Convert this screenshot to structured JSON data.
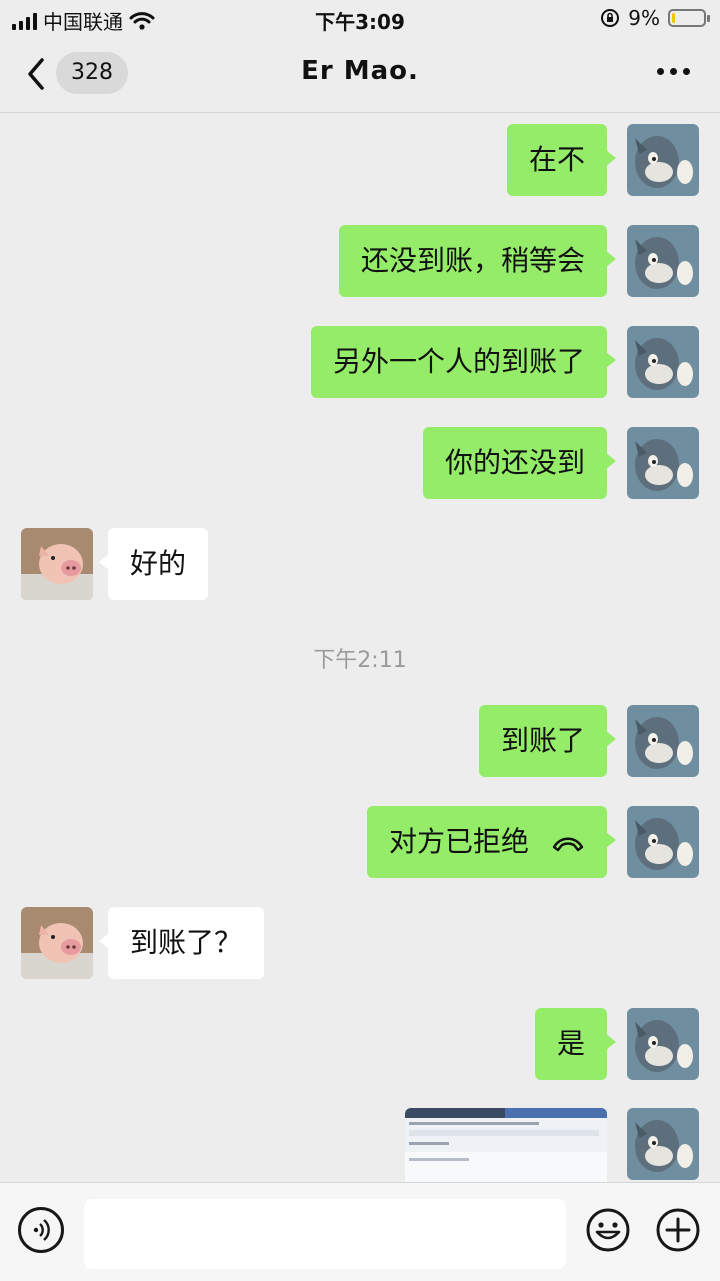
{
  "status_bar": {
    "carrier": "中国联通",
    "time": "下午3:09",
    "battery_percent": "9%",
    "battery_level": 0.09,
    "signal_icon": "signal-icon",
    "wifi_icon": "wifi-icon",
    "lock_icon": "rotation-lock-icon"
  },
  "nav": {
    "unread_count": "328",
    "title": "Er  Mao.",
    "back_icon": "chevron-left-icon",
    "more_icon": "more-dots-icon"
  },
  "messages": [
    {
      "sender": "me",
      "text": "在不"
    },
    {
      "sender": "me",
      "text": "还没到账，稍等会"
    },
    {
      "sender": "me",
      "text": "另外一个人的到账了"
    },
    {
      "sender": "me",
      "text": "你的还没到"
    },
    {
      "sender": "them",
      "text": "好的"
    },
    {
      "sender": "me",
      "text": "到账了"
    },
    {
      "sender": "me",
      "text": "对方已拒绝",
      "icon": "call-declined-icon"
    },
    {
      "sender": "them",
      "text": "到账了？"
    },
    {
      "sender": "me",
      "text": "是"
    },
    {
      "sender": "me",
      "type": "image",
      "icon": "screenshot-thumbnail"
    }
  ],
  "timestamp": "下午2:11",
  "input_bar": {
    "placeholder": "",
    "voice_icon": "voice-icon",
    "emoji_icon": "emoji-icon",
    "plus_icon": "plus-icon"
  },
  "colors": {
    "background": "#ededed",
    "my_bubble": "#95ec69",
    "their_bubble": "#ffffff",
    "battery_fill": "#f5c400"
  }
}
